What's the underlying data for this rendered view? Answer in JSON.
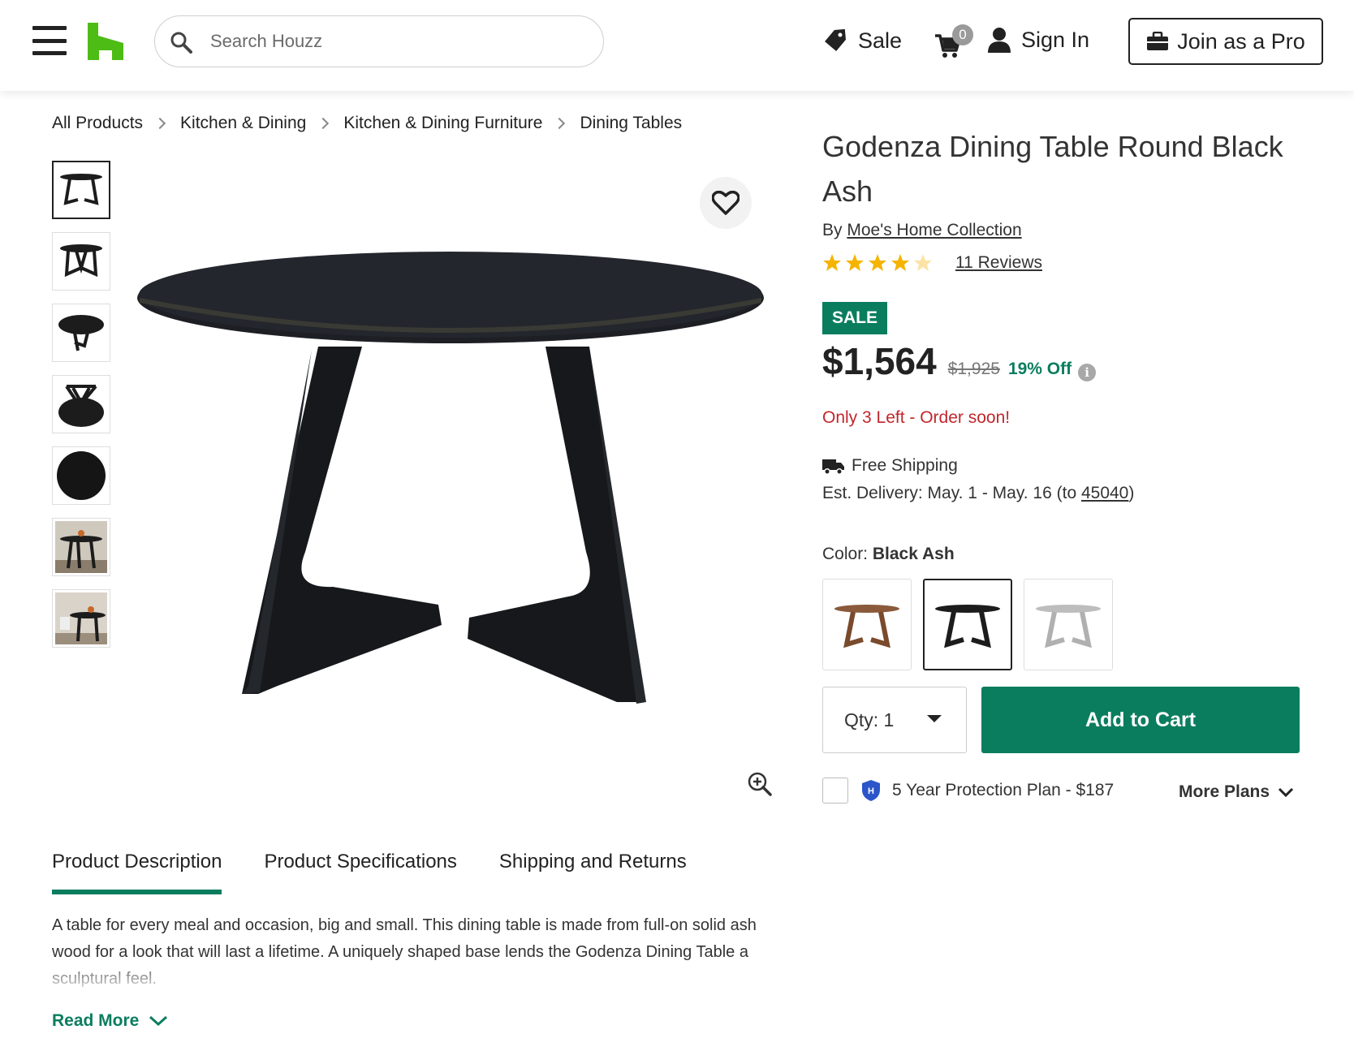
{
  "header": {
    "search_placeholder": "Search Houzz",
    "sale_label": "Sale",
    "cart_count": "0",
    "signin_label": "Sign In",
    "join_pro_label": "Join as a Pro",
    "brand_color": "#4dbc15"
  },
  "breadcrumb": [
    "All Products",
    "Kitchen & Dining",
    "Kitchen & Dining Furniture",
    "Dining Tables"
  ],
  "product": {
    "title": "Godenza Dining Table Round Black Ash",
    "by_prefix": "By",
    "brand": "Moe's Home Collection",
    "rating": 4.5,
    "rating_max": 5,
    "reviews_label": "11 Reviews",
    "sale_badge": "SALE",
    "price": "$1,564",
    "original_price": "$1,925",
    "discount": "19% Off",
    "stock_message": "Only 3 Left - Order soon!",
    "shipping_label": "Free Shipping",
    "delivery_prefix": "Est. Delivery: May. 1 - May. 16 (to ",
    "delivery_zip": "45040",
    "delivery_suffix": ")",
    "color_label": "Color:",
    "color_value": "Black Ash",
    "swatches": [
      {
        "name": "walnut",
        "color": "#8a5a3b"
      },
      {
        "name": "black-ash",
        "color": "#1c1c1c"
      },
      {
        "name": "grey",
        "color": "#b5b5b5"
      }
    ],
    "qty_label": "Qty: 1",
    "add_to_cart_label": "Add to Cart",
    "protection_label": "5 Year Protection Plan - $187",
    "more_plans_label": "More Plans"
  },
  "tabs": [
    "Product Description",
    "Product Specifications",
    "Shipping and Returns"
  ],
  "description": "A table for every meal and occasion, big and small. This dining table is made from full-on solid ash wood for a look that will last a lifetime. A uniquely shaped base lends the Godenza Dining Table a sculptural feel.",
  "read_more_label": "Read More",
  "colors": {
    "accent": "#0b7d5f",
    "stock_red": "#c0272d",
    "star": "#f5b400"
  },
  "icons": [
    "hamburger-icon",
    "houzz-logo",
    "search-icon",
    "tag-icon",
    "cart-icon",
    "user-icon",
    "briefcase-icon",
    "heart-icon",
    "zoom-in-icon",
    "star-icon",
    "info-icon",
    "truck-icon",
    "caret-down-icon",
    "shield-icon",
    "chevron-down-icon"
  ]
}
